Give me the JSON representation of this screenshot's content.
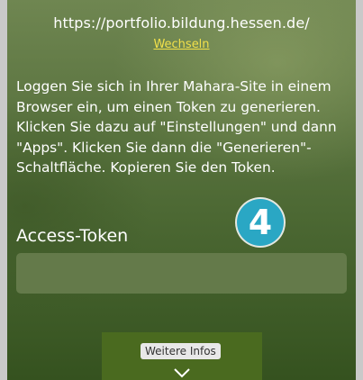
{
  "header": {
    "site_url": "https://portfolio.bildung.hessen.de/",
    "switch_label": "Wechseln"
  },
  "main": {
    "instructions": "Loggen Sie sich in Ihrer Mahara-Site in einem Browser ein, um einen Token zu generieren. Klicken Sie dazu auf \"Einstellungen\" und dann \"Apps\". Klicken Sie dann die \"Generieren\"-Schaltfläche. Kopieren Sie den Token.",
    "step_badge": "4",
    "token_label": "Access-Token",
    "token_value": "",
    "more_info_label": "Weitere Infos"
  },
  "icons": {
    "more_info_icon": "chevron-down-icon"
  },
  "colors": {
    "background": "#4d6934",
    "link": "#f2e04a",
    "badge": "#2aa7c4",
    "input": "#647a4a",
    "button": "#4a6a1f"
  }
}
